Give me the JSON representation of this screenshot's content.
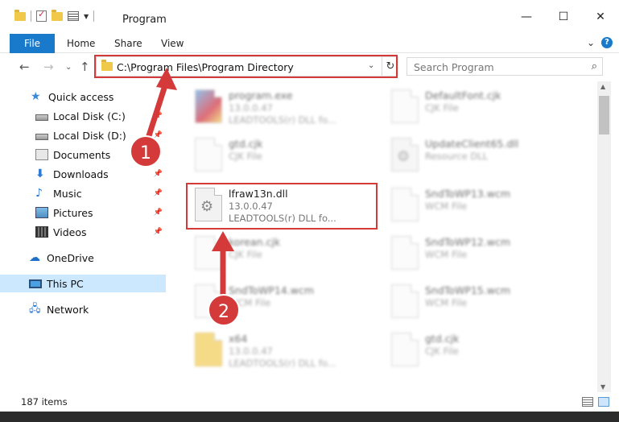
{
  "window": {
    "title": "Program",
    "controls": {
      "minimize": "—",
      "maximize": "☐",
      "close": "✕"
    }
  },
  "ribbon": {
    "tabs": [
      "File",
      "Home",
      "Share",
      "View"
    ],
    "expand": "⌄",
    "help": "?"
  },
  "navigation": {
    "back": "←",
    "forward": "→",
    "recent": "⌄",
    "up": "↑",
    "address": "C:\\Program Files\\Program Directory",
    "address_dropdown": "⌄",
    "refresh": "↻",
    "search_placeholder": "Search Program",
    "search_icon": "⌕"
  },
  "sidebar": {
    "items": [
      {
        "label": "Quick access",
        "icon": "star-icon",
        "pinned": false
      },
      {
        "label": "Local Disk (C:)",
        "icon": "drive-icon",
        "pinned": true
      },
      {
        "label": "Local Disk (D:)",
        "icon": "drive-icon",
        "pinned": true
      },
      {
        "label": "Documents",
        "icon": "documents-icon",
        "pinned": true
      },
      {
        "label": "Downloads",
        "icon": "download-icon",
        "pinned": true
      },
      {
        "label": "Music",
        "icon": "music-icon",
        "pinned": true
      },
      {
        "label": "Pictures",
        "icon": "pictures-icon",
        "pinned": true
      },
      {
        "label": "Videos",
        "icon": "videos-icon",
        "pinned": true
      },
      {
        "label": "OneDrive",
        "icon": "cloud-icon",
        "pinned": false
      },
      {
        "label": "This PC",
        "icon": "computer-icon",
        "pinned": false,
        "selected": true
      },
      {
        "label": "Network",
        "icon": "network-icon",
        "pinned": false
      }
    ],
    "pin_glyph": "📌"
  },
  "files": {
    "left": [
      {
        "name": "program.exe",
        "line2": "13.0.0.47",
        "line3": "LEADTOOLS(r) DLL fo...",
        "icon": "exe-icon",
        "blurred": true
      },
      {
        "name": "gtd.cjk",
        "line2": "CJK File",
        "line3": "",
        "icon": "file-icon",
        "blurred": true
      },
      {
        "name": "lfraw13n.dll",
        "line2": "13.0.0.47",
        "line3": "LEADTOOLS(r) DLL fo...",
        "icon": "dll-gear-icon",
        "blurred": false
      },
      {
        "name": "korean.cjk",
        "line2": "CJK File",
        "line3": "",
        "icon": "file-icon",
        "blurred": true
      },
      {
        "name": "SndToWP14.wcm",
        "line2": "WCM File",
        "line3": "",
        "icon": "file-icon",
        "blurred": true
      },
      {
        "name": "x64",
        "line2": "13.0.0.47",
        "line3": "LEADTOOLS(r) DLL fo...",
        "icon": "folder-icon",
        "blurred": true
      }
    ],
    "right": [
      {
        "name": "DefaultFont.cjk",
        "line2": "CJK File",
        "line3": "",
        "icon": "file-icon",
        "blurred": true
      },
      {
        "name": "UpdateClient65.dll",
        "line2": "Resource DLL",
        "line3": "",
        "icon": "dll-gear-icon",
        "blurred": true
      },
      {
        "name": "SndToWP13.wcm",
        "line2": "WCM File",
        "line3": "",
        "icon": "file-icon",
        "blurred": true
      },
      {
        "name": "SndToWP12.wcm",
        "line2": "WCM File",
        "line3": "",
        "icon": "file-icon",
        "blurred": true
      },
      {
        "name": "SndToWP15.wcm",
        "line2": "WCM File",
        "line3": "",
        "icon": "file-icon",
        "blurred": true
      },
      {
        "name": "gtd.cjk",
        "line2": "CJK File",
        "line3": "",
        "icon": "file-icon",
        "blurred": true
      }
    ]
  },
  "annotations": {
    "step1": "1",
    "step2": "2",
    "color": "#d43a3a"
  },
  "status": {
    "item_count": "187 items"
  }
}
